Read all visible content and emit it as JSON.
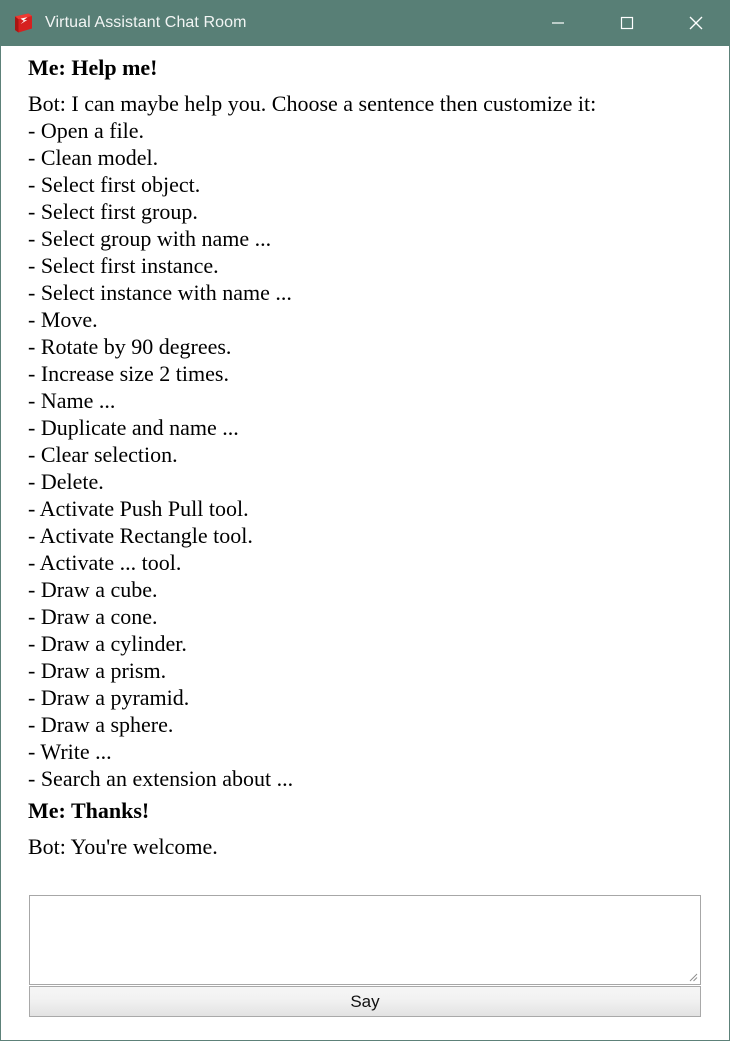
{
  "window": {
    "title": "Virtual Assistant Chat Room",
    "icon": "sketchup-logo-icon",
    "titlebar_color": "#587f76",
    "title_color": "#f2f5f4",
    "border_color": "#5d8179",
    "controls": [
      {
        "name": "minimize",
        "glyph": "—"
      },
      {
        "name": "maximize",
        "glyph": "□"
      },
      {
        "name": "close",
        "glyph": "✕"
      }
    ]
  },
  "chat": {
    "messages": [
      {
        "speaker": "Me",
        "bold": true,
        "head": "Me: Help me!",
        "lines": []
      },
      {
        "speaker": "Bot",
        "bold": false,
        "head": "Bot: I can maybe help you. Choose a sentence then customize it:",
        "lines": [
          "- Open a file.",
          "- Clean model.",
          "- Select first object.",
          "- Select first group.",
          "- Select group with name ...",
          "- Select first instance.",
          "- Select instance with name ...",
          "- Move.",
          "- Rotate by 90 degrees.",
          "- Increase size 2 times.",
          "- Name ...",
          "- Duplicate and name ...",
          "- Clear selection.",
          "- Delete.",
          "- Activate Push Pull tool.",
          "- Activate Rectangle tool.",
          "- Activate ... tool.",
          "- Draw a cube.",
          "- Draw a cone.",
          "- Draw a cylinder.",
          "- Draw a prism.",
          "- Draw a pyramid.",
          "- Draw a sphere.",
          "- Write ...",
          "- Search an extension about ..."
        ]
      },
      {
        "speaker": "Me",
        "bold": true,
        "head": "Me: Thanks!",
        "lines": []
      },
      {
        "speaker": "Bot",
        "bold": false,
        "head": "Bot: You're welcome.",
        "lines": []
      }
    ]
  },
  "composer": {
    "input_value": "",
    "input_placeholder": "",
    "say_label": "Say"
  }
}
